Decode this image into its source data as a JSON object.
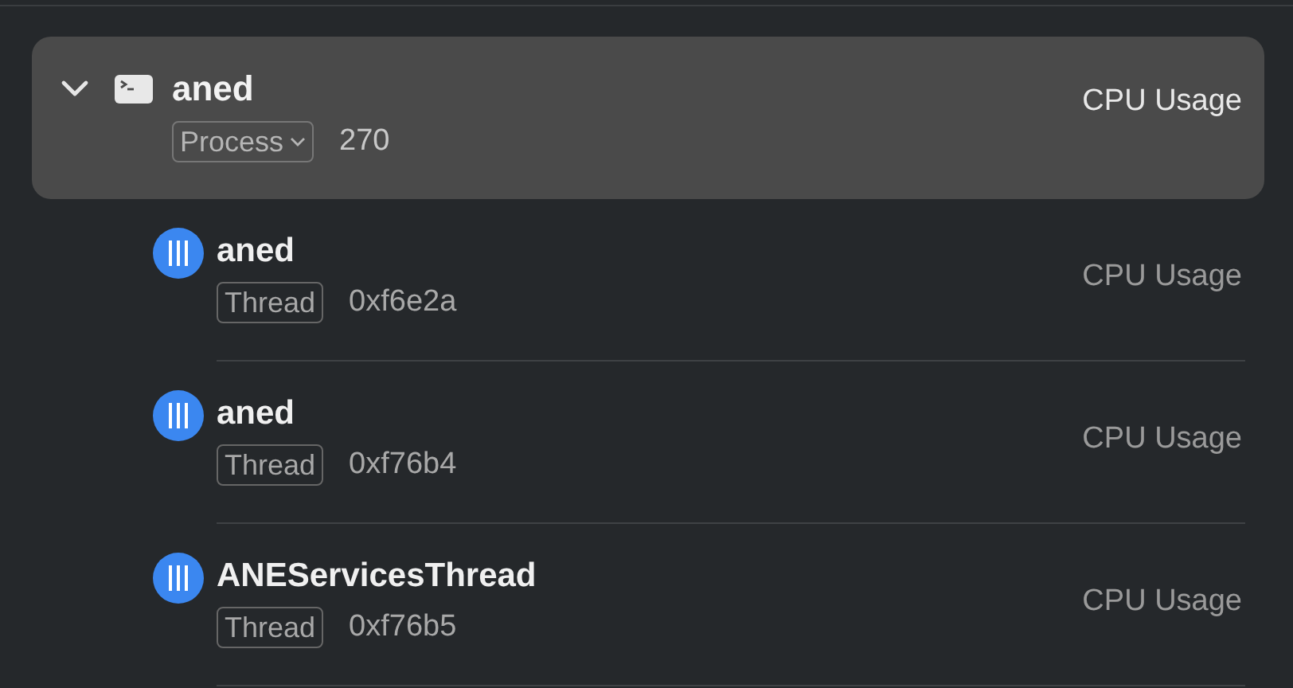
{
  "process": {
    "name": "aned",
    "type": "Process",
    "pid": "270",
    "metric": "CPU Usage",
    "expanded": true,
    "selected": true
  },
  "threads": [
    {
      "name": "aned",
      "type": "Thread",
      "tid": "0xf6e2a",
      "metric": "CPU Usage"
    },
    {
      "name": "aned",
      "type": "Thread",
      "tid": "0xf76b4",
      "metric": "CPU Usage"
    },
    {
      "name": "ANEServicesThread",
      "type": "Thread",
      "tid": "0xf76b5",
      "metric": "CPU Usage"
    }
  ]
}
